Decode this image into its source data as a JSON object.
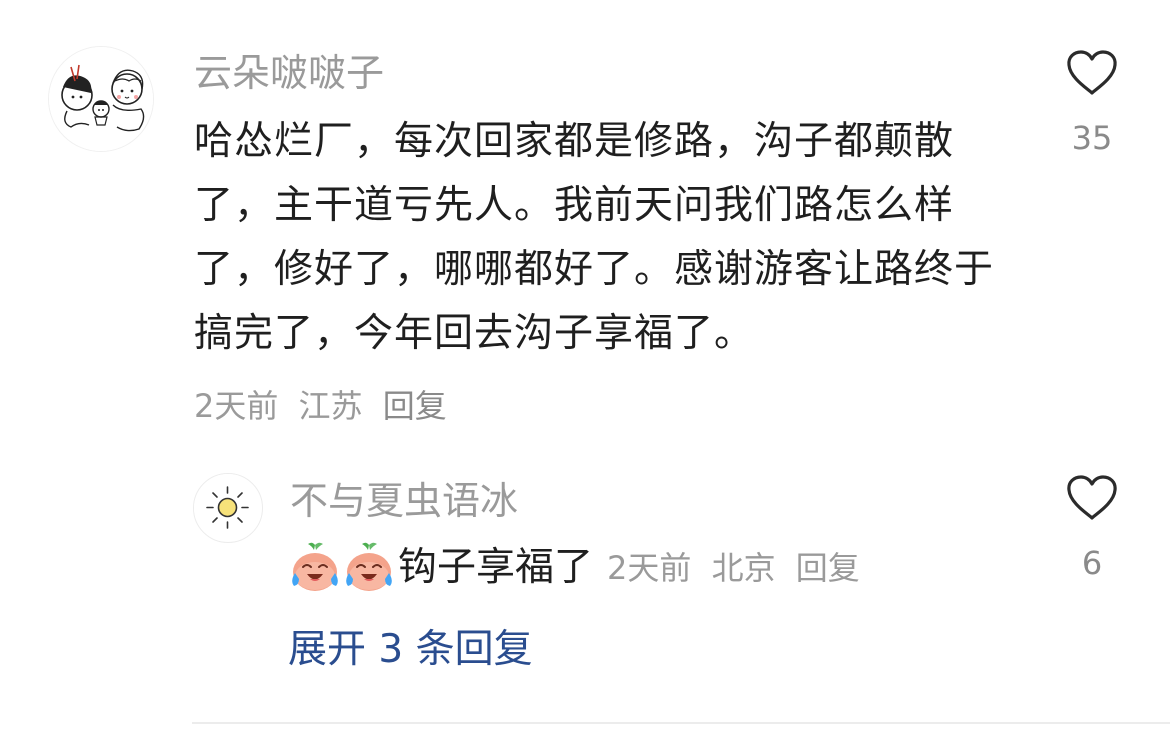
{
  "comment": {
    "username": "云朵啵啵子",
    "text": "哈怂烂厂，每次回家都是修路，沟子都颠散了，主干道亏先人。我前天问我们路怎么样了，修好了，哪哪都好了。感谢游客让路终于搞完了，今年回去沟子享福了。",
    "time": "2天前",
    "location": "江苏",
    "reply_label": "回复",
    "like_count": "35",
    "avatar_icon": "doodle-avatar-icon"
  },
  "reply": {
    "username": "不与夏虫语冰",
    "emoji_icon": "crying-laughing-peach-emoji",
    "text": "钩子享福了",
    "time": "2天前",
    "location": "北京",
    "reply_label": "回复",
    "like_count": "6",
    "avatar_icon": "sun-avatar-icon"
  },
  "expand": {
    "label": "展开 3 条回复"
  },
  "colors": {
    "username": "#9a9a9a",
    "text": "#1f1f1f",
    "link": "#2a4d8f",
    "divider": "#ececec"
  }
}
